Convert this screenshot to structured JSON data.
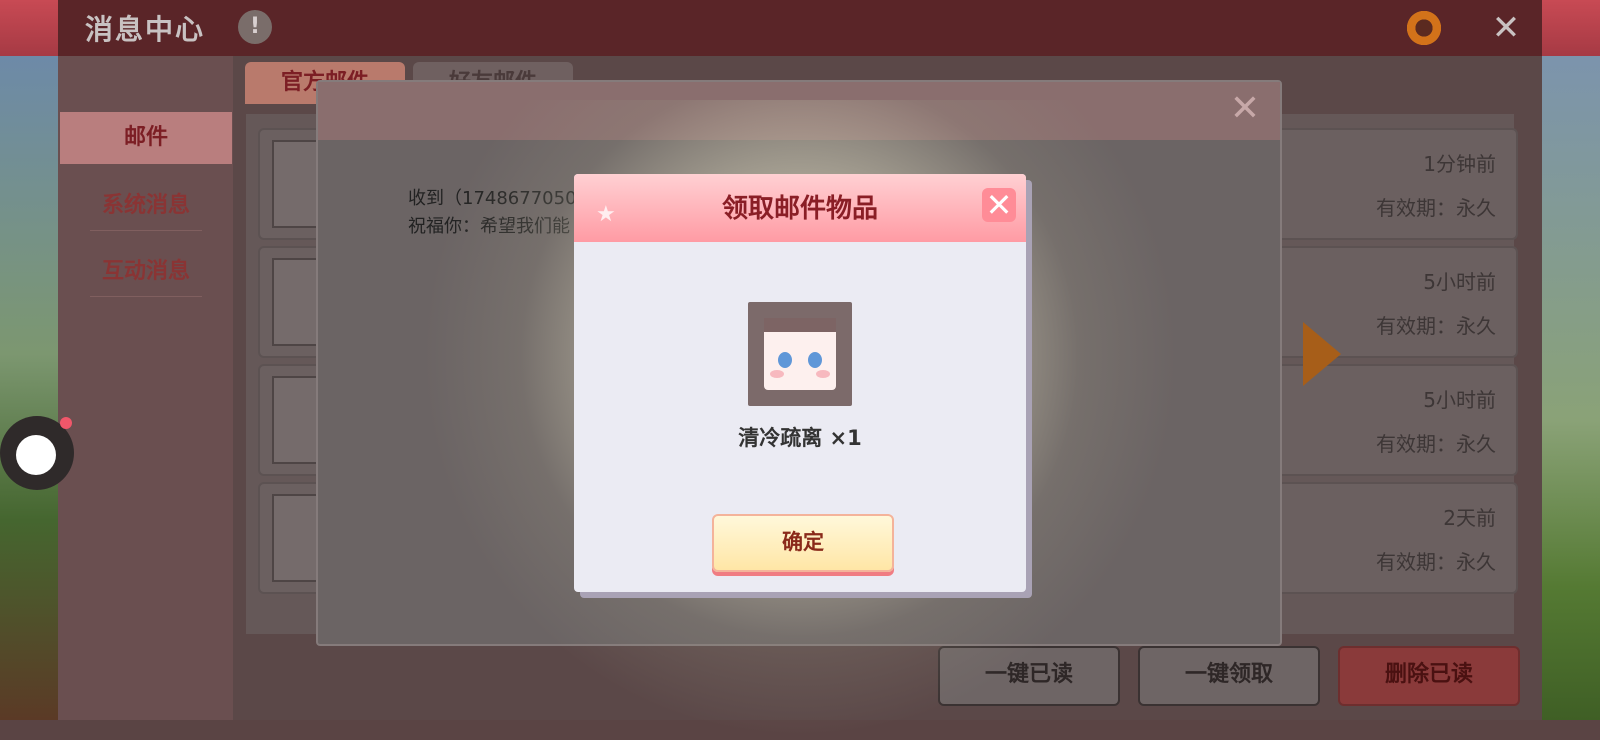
{
  "header": {
    "title": "消息中心",
    "info_icon": "!",
    "close_icon": "✕"
  },
  "sidebar": {
    "items": [
      {
        "label": "邮件",
        "active": true
      },
      {
        "label": "系统消息",
        "active": false
      },
      {
        "label": "互动消息",
        "active": false
      }
    ]
  },
  "tabs": [
    {
      "label": "官方邮件",
      "active": true
    },
    {
      "label": "好友邮件",
      "active": false
    }
  ],
  "mails": [
    {
      "time": "1分钟前",
      "valid": "有效期：永久"
    },
    {
      "time": "5小时前",
      "valid": "有效期：永久"
    },
    {
      "time": "5小时前",
      "valid": "有效期：永久"
    },
    {
      "time": "2天前",
      "valid": "有效期：永久"
    }
  ],
  "mail_detail": {
    "line1": "收到（1748677050",
    "line2": "祝福你：希望我们能",
    "close_icon": "✕"
  },
  "bottom_buttons": {
    "mark_read": "一键已读",
    "claim_all": "一键领取",
    "delete_read": "删除已读"
  },
  "popup": {
    "title": "领取邮件物品",
    "close_icon": "✕",
    "item_name": "清冷疏离 ×1",
    "confirm": "确定"
  },
  "colors": {
    "header": "#a63a44",
    "popup_header": "#ff9ba4",
    "confirm_bg": "#ffe6a6",
    "arrow": "#a75e19"
  }
}
